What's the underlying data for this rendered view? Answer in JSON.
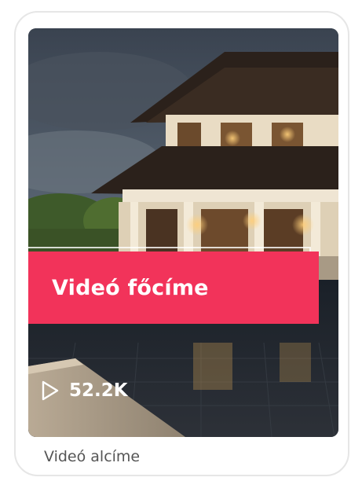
{
  "card": {
    "title": "Videó főcíme",
    "subtitle": "Videó alcíme",
    "views": "52.2K",
    "play_icon": "play-triangle-outline-icon",
    "accent_color": "#f2335a"
  }
}
